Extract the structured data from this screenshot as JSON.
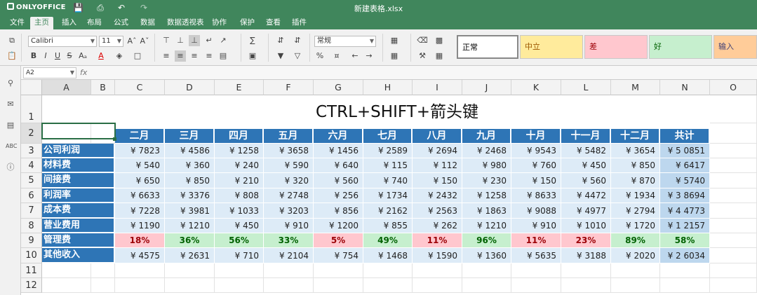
{
  "app": {
    "name": "ONLYOFFICE",
    "file_title": "新建表格.xlsx"
  },
  "menu_tabs": [
    "文件",
    "主页",
    "插入",
    "布局",
    "公式",
    "数据",
    "数据透视表",
    "协作",
    "保护",
    "查看",
    "插件"
  ],
  "active_tab": "主页",
  "toolbar": {
    "font_name": "Calibri",
    "font_size": "11",
    "number_format": "常规",
    "cell_styles": [
      {
        "label": "正常",
        "bg": "#ffffff",
        "color": "#000000"
      },
      {
        "label": "中立",
        "bg": "#ffeb9c",
        "color": "#9c5700"
      },
      {
        "label": "差",
        "bg": "#ffc7ce",
        "color": "#9c0006"
      },
      {
        "label": "好",
        "bg": "#c6efce",
        "color": "#006100"
      },
      {
        "label": "输入",
        "bg": "#ffcc99",
        "color": "#3f3f76"
      }
    ]
  },
  "formula_bar": {
    "name_box": "A2",
    "fx_label": "fx",
    "content": ""
  },
  "columns": [
    "A",
    "B",
    "C",
    "D",
    "E",
    "F",
    "G",
    "H",
    "I",
    "J",
    "K",
    "L",
    "M",
    "N",
    "O"
  ],
  "rows": [
    "1",
    "2",
    "3",
    "4",
    "5",
    "6",
    "7",
    "8",
    "9",
    "10",
    "11",
    "12"
  ],
  "sheet": {
    "title": "CTRL+SHIFT+箭头键",
    "month_headers": [
      "二月",
      "三月",
      "四月",
      "五月",
      "六月",
      "七月",
      "八月",
      "九月",
      "十月",
      "十一月",
      "十二月",
      "共计"
    ],
    "data_rows": [
      {
        "label": "公司利润",
        "type": "money",
        "values": [
          "¥ 7823",
          "¥ 4586",
          "¥ 1258",
          "¥ 3658",
          "¥ 1456",
          "¥ 2589",
          "¥ 2694",
          "¥ 2468",
          "¥ 9543",
          "¥ 5482",
          "¥ 3654",
          "¥ 5 0851"
        ]
      },
      {
        "label": "材料费",
        "type": "money",
        "values": [
          "¥ 540",
          "¥ 360",
          "¥ 240",
          "¥ 590",
          "¥ 640",
          "¥ 115",
          "¥ 112",
          "¥ 980",
          "¥ 760",
          "¥ 450",
          "¥ 850",
          "¥ 6417"
        ]
      },
      {
        "label": "间接费",
        "type": "money",
        "values": [
          "¥ 650",
          "¥ 850",
          "¥ 210",
          "¥ 320",
          "¥ 560",
          "¥ 740",
          "¥ 150",
          "¥ 230",
          "¥ 150",
          "¥ 560",
          "¥ 870",
          "¥ 5740"
        ]
      },
      {
        "label": "利润率",
        "type": "money",
        "values": [
          "¥ 6633",
          "¥ 3376",
          "¥ 808",
          "¥ 2748",
          "¥ 256",
          "¥ 1734",
          "¥ 2432",
          "¥ 1258",
          "¥ 8633",
          "¥ 4472",
          "¥ 1934",
          "¥ 3 8694"
        ]
      },
      {
        "label": "成本费",
        "type": "money",
        "values": [
          "¥ 7228",
          "¥ 3981",
          "¥ 1033",
          "¥ 3203",
          "¥ 856",
          "¥ 2162",
          "¥ 2563",
          "¥ 1863",
          "¥ 9088",
          "¥ 4977",
          "¥ 2794",
          "¥ 4 4773"
        ]
      },
      {
        "label": "营业费用",
        "type": "money",
        "values": [
          "¥ 1190",
          "¥ 1210",
          "¥ 450",
          "¥ 910",
          "¥ 1200",
          "¥ 855",
          "¥ 262",
          "¥ 1210",
          "¥ 910",
          "¥ 1010",
          "¥ 1720",
          "¥ 1 2157"
        ]
      },
      {
        "label": "管理费",
        "type": "pct",
        "values": [
          "18%",
          "36%",
          "56%",
          "33%",
          "5%",
          "49%",
          "11%",
          "96%",
          "11%",
          "23%",
          "89%",
          "58%"
        ],
        "status": [
          "bad",
          "good",
          "good",
          "good",
          "bad",
          "good",
          "bad",
          "good",
          "bad",
          "bad",
          "good",
          "good"
        ]
      },
      {
        "label": "其他收入",
        "type": "money",
        "values": [
          "¥ 4575",
          "¥ 2631",
          "¥ 710",
          "¥ 2104",
          "¥ 754",
          "¥ 1468",
          "¥ 1590",
          "¥ 1360",
          "¥ 5635",
          "¥ 3188",
          "¥ 2020",
          "¥ 2 6034"
        ]
      }
    ]
  }
}
